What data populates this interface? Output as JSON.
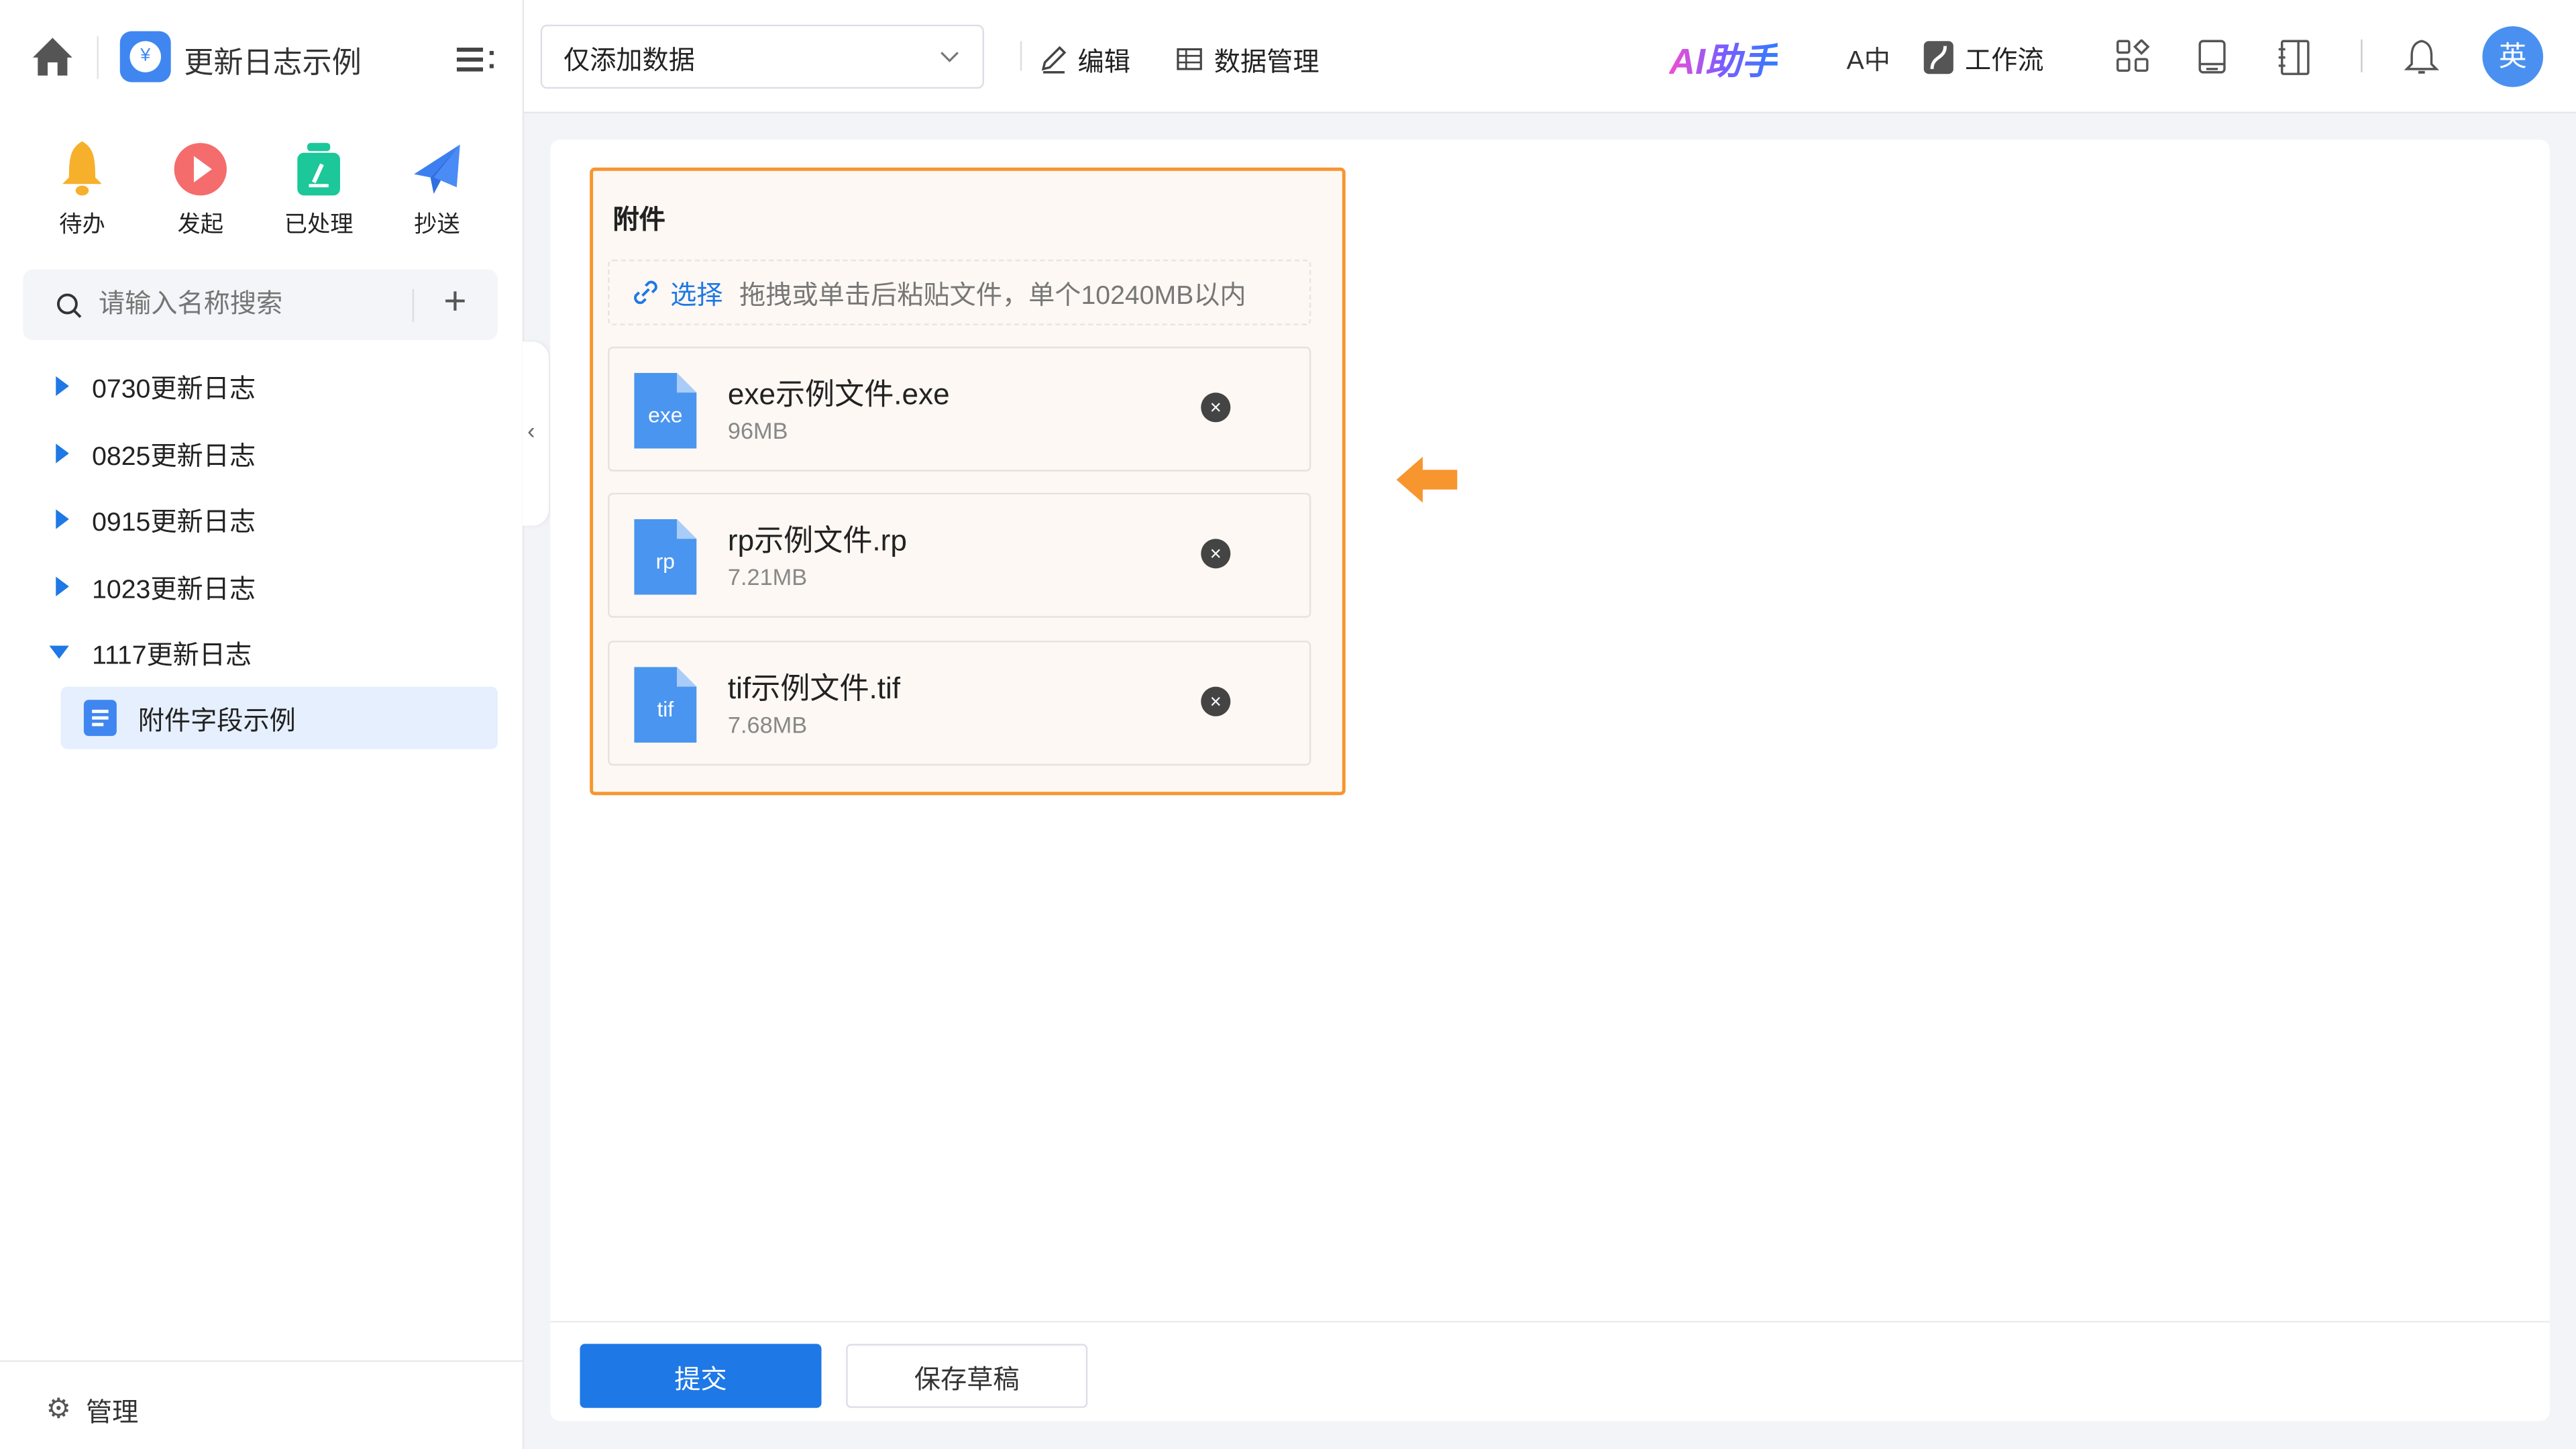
{
  "app": {
    "title": "更新日志示例"
  },
  "quick_actions": [
    {
      "label": "待办",
      "icon": "bell-icon",
      "color": "#f7b02b"
    },
    {
      "label": "发起",
      "icon": "play-icon",
      "color": "#f56c6c"
    },
    {
      "label": "已处理",
      "icon": "processed-icon",
      "color": "#1cc79a"
    },
    {
      "label": "抄送",
      "icon": "send-icon",
      "color": "#3d7ff0"
    }
  ],
  "search": {
    "placeholder": "请输入名称搜索"
  },
  "tree": [
    {
      "label": "0730更新日志",
      "expanded": false
    },
    {
      "label": "0825更新日志",
      "expanded": false
    },
    {
      "label": "0915更新日志",
      "expanded": false
    },
    {
      "label": "1023更新日志",
      "expanded": false
    },
    {
      "label": "1117更新日志",
      "expanded": true,
      "children": [
        {
          "label": "附件字段示例",
          "selected": true
        }
      ]
    }
  ],
  "footer": {
    "manage_label": "管理"
  },
  "toolbar": {
    "view_select": "仅添加数据",
    "edit": "编辑",
    "data_manage": "数据管理",
    "ai": "AI助手",
    "workflow": "工作流",
    "avatar": "英"
  },
  "form": {
    "field_label": "附件",
    "upload": {
      "select_label": "选择",
      "hint": "拖拽或单击后粘贴文件，单个10240MB以内"
    },
    "files": [
      {
        "name": "exe示例文件.exe",
        "size": "96MB",
        "ext": "exe"
      },
      {
        "name": "rp示例文件.rp",
        "size": "7.21MB",
        "ext": "rp"
      },
      {
        "name": "tif示例文件.tif",
        "size": "7.68MB",
        "ext": "tif"
      }
    ],
    "remove_glyph": "×"
  },
  "actions": {
    "submit": "提交",
    "save_draft": "保存草稿"
  },
  "colors": {
    "primary": "#1e78e6",
    "highlight": "#f7952e"
  }
}
